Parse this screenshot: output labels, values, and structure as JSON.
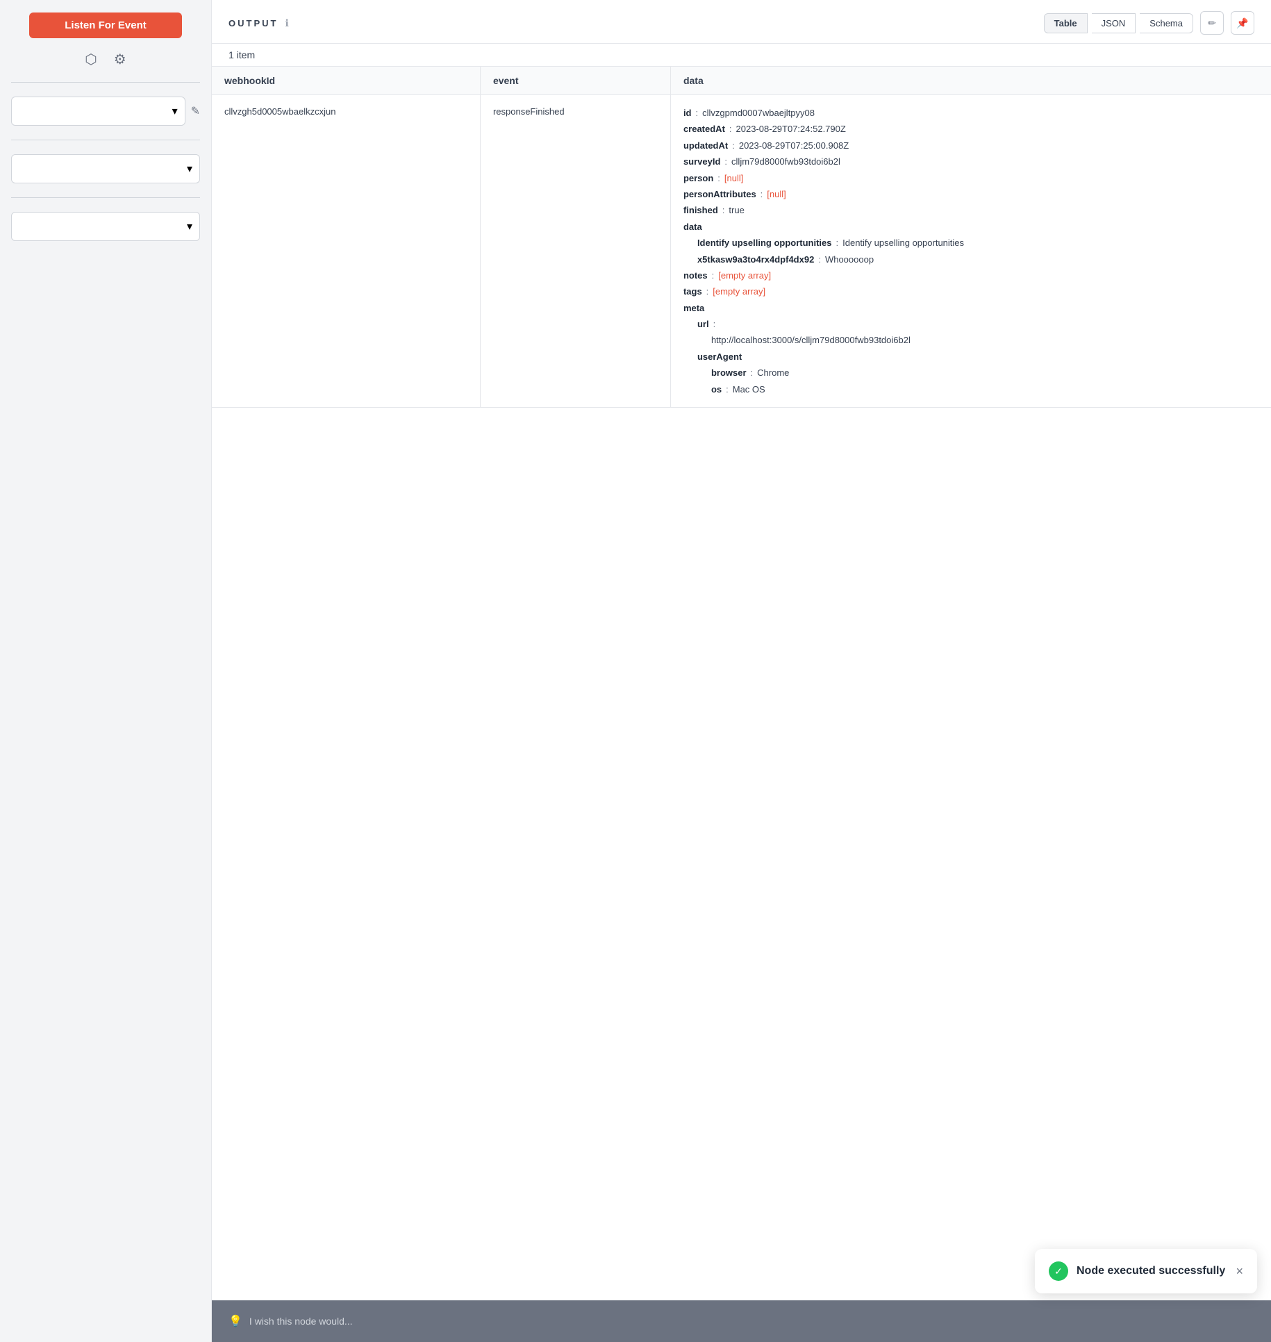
{
  "sidebar": {
    "listen_btn_label": "Listen For Event",
    "dropdown1_placeholder": "",
    "dropdown2_placeholder": "",
    "dropdown3_placeholder": ""
  },
  "header": {
    "output_label": "OUTPUT",
    "view_table": "Table",
    "view_json": "JSON",
    "view_schema": "Schema"
  },
  "item_count": "1 item",
  "table": {
    "columns": [
      "webhookId",
      "event",
      "data"
    ],
    "rows": [
      {
        "webhookId": "cllvzgh5d0005wbaelkzcxjun",
        "event": "responseFinished",
        "data": {
          "id": "cllvzgpmd0007wbaejltpyy08",
          "createdAt": "2023-08-29T07:24:52.790Z",
          "updatedAt": "2023-08-29T07:25:00.908Z",
          "surveyId": "clljm79d8000fwb93tdoi6b2l",
          "person": "[null]",
          "personAttributes": "[null]",
          "finished": "true",
          "data_nested": {
            "r95ciesvmea0x8th6xapy18b": "Identify upselling opportunities",
            "x5tkasw9a3to4rx4dpf4dx92": "Whoooooop"
          },
          "notes": "[empty array]",
          "tags": "[empty array]",
          "meta": {
            "url": "http://localhost:3000/s/clljm79d8000fwb93tdoi6b2l",
            "userAgent": {
              "browser": "Chrome",
              "os": "Mac OS"
            }
          }
        }
      }
    ]
  },
  "feedback": {
    "placeholder": "I wish this node would..."
  },
  "toast": {
    "message": "Node executed successfully",
    "close_label": "×"
  },
  "icons": {
    "cube": "⬡",
    "gear": "⚙",
    "chevron_down": "▾",
    "edit": "✎",
    "pin": "📌",
    "pencil": "✏",
    "info": "ℹ",
    "check": "✓",
    "lightbulb": "💡"
  }
}
